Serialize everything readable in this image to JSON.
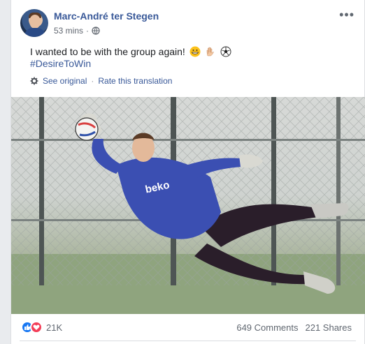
{
  "post": {
    "author": "Marc-André ter Stegen",
    "time": "53 mins",
    "text": "I wanted to be with the group again! ",
    "emojis": [
      "grinning-face-emoji",
      "raised-hand-emoji",
      "soccer-ball-emoji"
    ],
    "hashtag": "#DesireToWin",
    "see_original": "See original",
    "separator": "·",
    "rate_translation": "Rate this translation",
    "photo_text": "beko"
  },
  "footer": {
    "reaction_count": "21K",
    "comments": "649 Comments",
    "shares": "221 Shares"
  },
  "colors": {
    "link": "#385898",
    "like": "#1877f2",
    "love": "#f33e58",
    "kit": "#3b4fb2"
  }
}
